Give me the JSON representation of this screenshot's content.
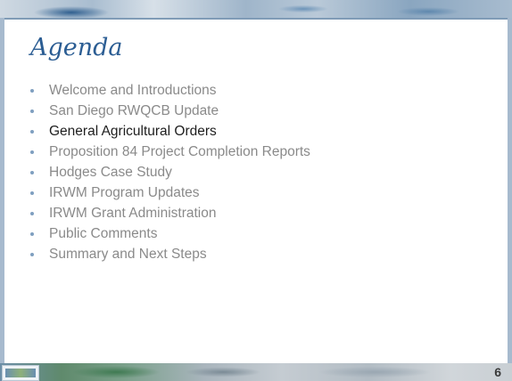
{
  "slide": {
    "title": "Agenda",
    "page_number": "6",
    "accent_color": "#2b5d93",
    "bullet_color": "#7f9fc0",
    "inactive_text_color": "#8a8a8a",
    "active_text_color": "#1e1e1e"
  },
  "agenda": {
    "items": [
      {
        "label": "Welcome and Introductions",
        "active": false
      },
      {
        "label": "San Diego RWQCB Update",
        "active": false
      },
      {
        "label": "General Agricultural Orders",
        "active": true
      },
      {
        "label": "Proposition 84 Project Completion Reports",
        "active": false
      },
      {
        "label": "Hodges Case Study",
        "active": false
      },
      {
        "label": "IRWM Program Updates",
        "active": false
      },
      {
        "label": "IRWM Grant Administration",
        "active": false
      },
      {
        "label": "Public Comments",
        "active": false
      },
      {
        "label": "Summary and Next Steps",
        "active": false
      }
    ]
  }
}
